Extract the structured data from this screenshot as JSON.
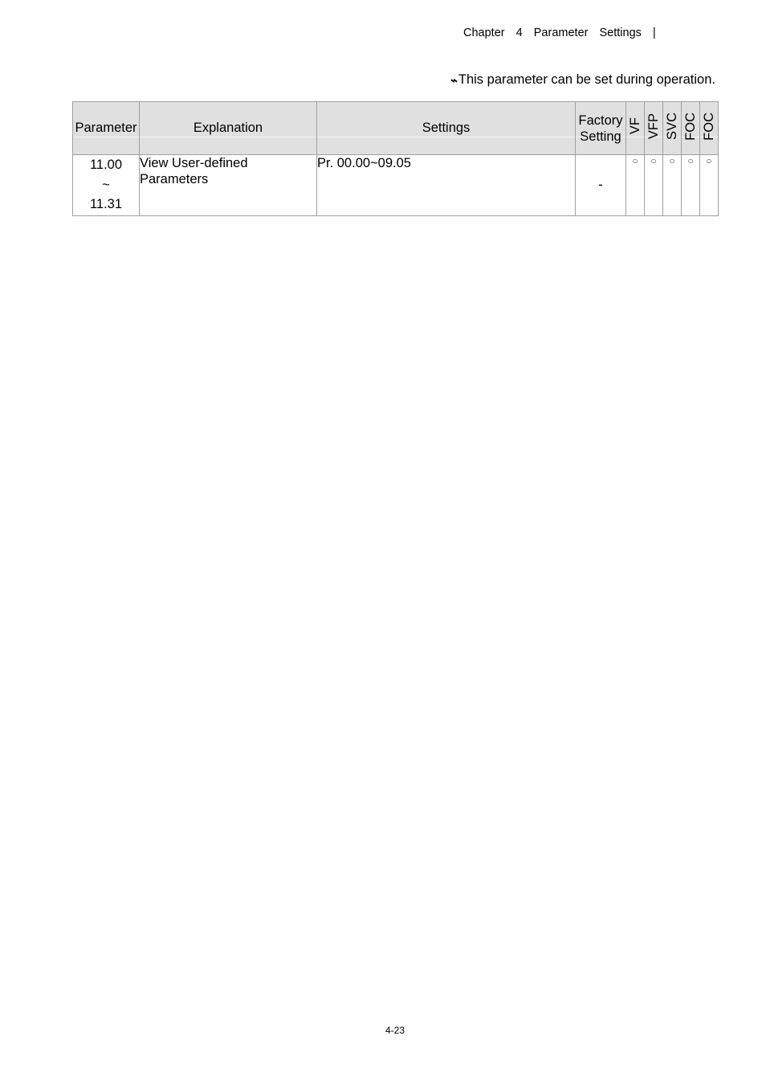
{
  "header": {
    "running_title": "Chapter  4  Parameter  Settings  |"
  },
  "note": {
    "icon": "lightning-bolt-icon",
    "icon_glyph": "ϟ",
    "text": "This parameter can be set during operation."
  },
  "table": {
    "headers": {
      "parameter": "Parameter",
      "explanation": "Explanation",
      "settings": "Settings",
      "factory_line1": "Factory",
      "factory_line2": "Setting",
      "modes": [
        "VF",
        "VFP",
        "SVC",
        "FOC",
        "FOC"
      ]
    },
    "rows": [
      {
        "param_start": "11.00",
        "param_sep": "~",
        "param_end": "11.31",
        "explanation_line1": "View User-defined",
        "explanation_line2": "Parameters",
        "settings": "Pr. 00.00~09.05",
        "factory": "-",
        "modes": [
          "○",
          "○",
          "○",
          "○",
          "○"
        ]
      }
    ]
  },
  "footer": {
    "page_number": "4-23"
  }
}
